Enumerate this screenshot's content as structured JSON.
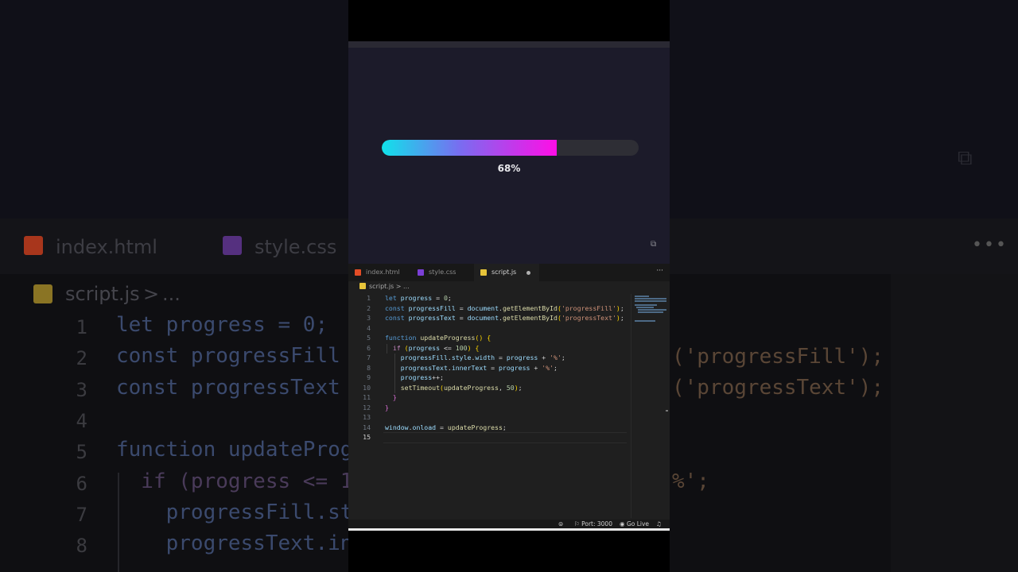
{
  "background": {
    "tabs": [
      {
        "label": "index.html",
        "icon": "html5-icon",
        "color": "#e44d26"
      },
      {
        "label": "style.css",
        "icon": "css3-icon",
        "color": "#7b3fd6"
      }
    ],
    "breadcrumb": {
      "file": "script.js",
      "rest": "..."
    },
    "line_numbers": [
      "1",
      "2",
      "3",
      "4",
      "5",
      "6",
      "7",
      "8"
    ],
    "code_left": [
      "let progress = 0;",
      "const progressFill",
      "const progressText",
      "",
      "function updateProg",
      "  if (progress <= 1",
      "    progressFill.st",
      "    progressText.in"
    ],
    "code_right": [
      "('progressFill');",
      "('progressText');",
      "%';"
    ]
  },
  "preview": {
    "progress_percent": 68,
    "progress_text": "68%",
    "gradient": [
      "#10e2ea",
      "#ff0ee6"
    ]
  },
  "editor": {
    "tabs": [
      {
        "label": "index.html",
        "icon": "html5-icon",
        "color": "#e44d26"
      },
      {
        "label": "style.css",
        "icon": "css3-icon",
        "color": "#7b3fd6"
      },
      {
        "label": "script.js",
        "icon": "js-icon",
        "color": "#e7c43a",
        "active": true
      }
    ],
    "more_label": "···",
    "breadcrumb": {
      "file": "script.js",
      "rest": "> ..."
    },
    "code_lines": [
      "let progress = 0;",
      "const progressFill = document.getElementById('progressFill');",
      "const progressText = document.getElementById('progressText');",
      "",
      "function updateProgress() {",
      "  if (progress <= 100) {",
      "    progressFill.style.width = progress + '%';",
      "    progressText.innerText = progress + '%';",
      "    progress++;",
      "    setTimeout(updateProgress, 50);",
      "  }",
      "}",
      "",
      "window.onload = updateProgress;",
      ""
    ],
    "line_numbers": [
      "1",
      "2",
      "3",
      "4",
      "5",
      "6",
      "7",
      "8",
      "9",
      "10",
      "11",
      "12",
      "13",
      "14",
      "15"
    ]
  },
  "statusbar": {
    "port": "Port: 3000",
    "golive": "Go Live"
  }
}
